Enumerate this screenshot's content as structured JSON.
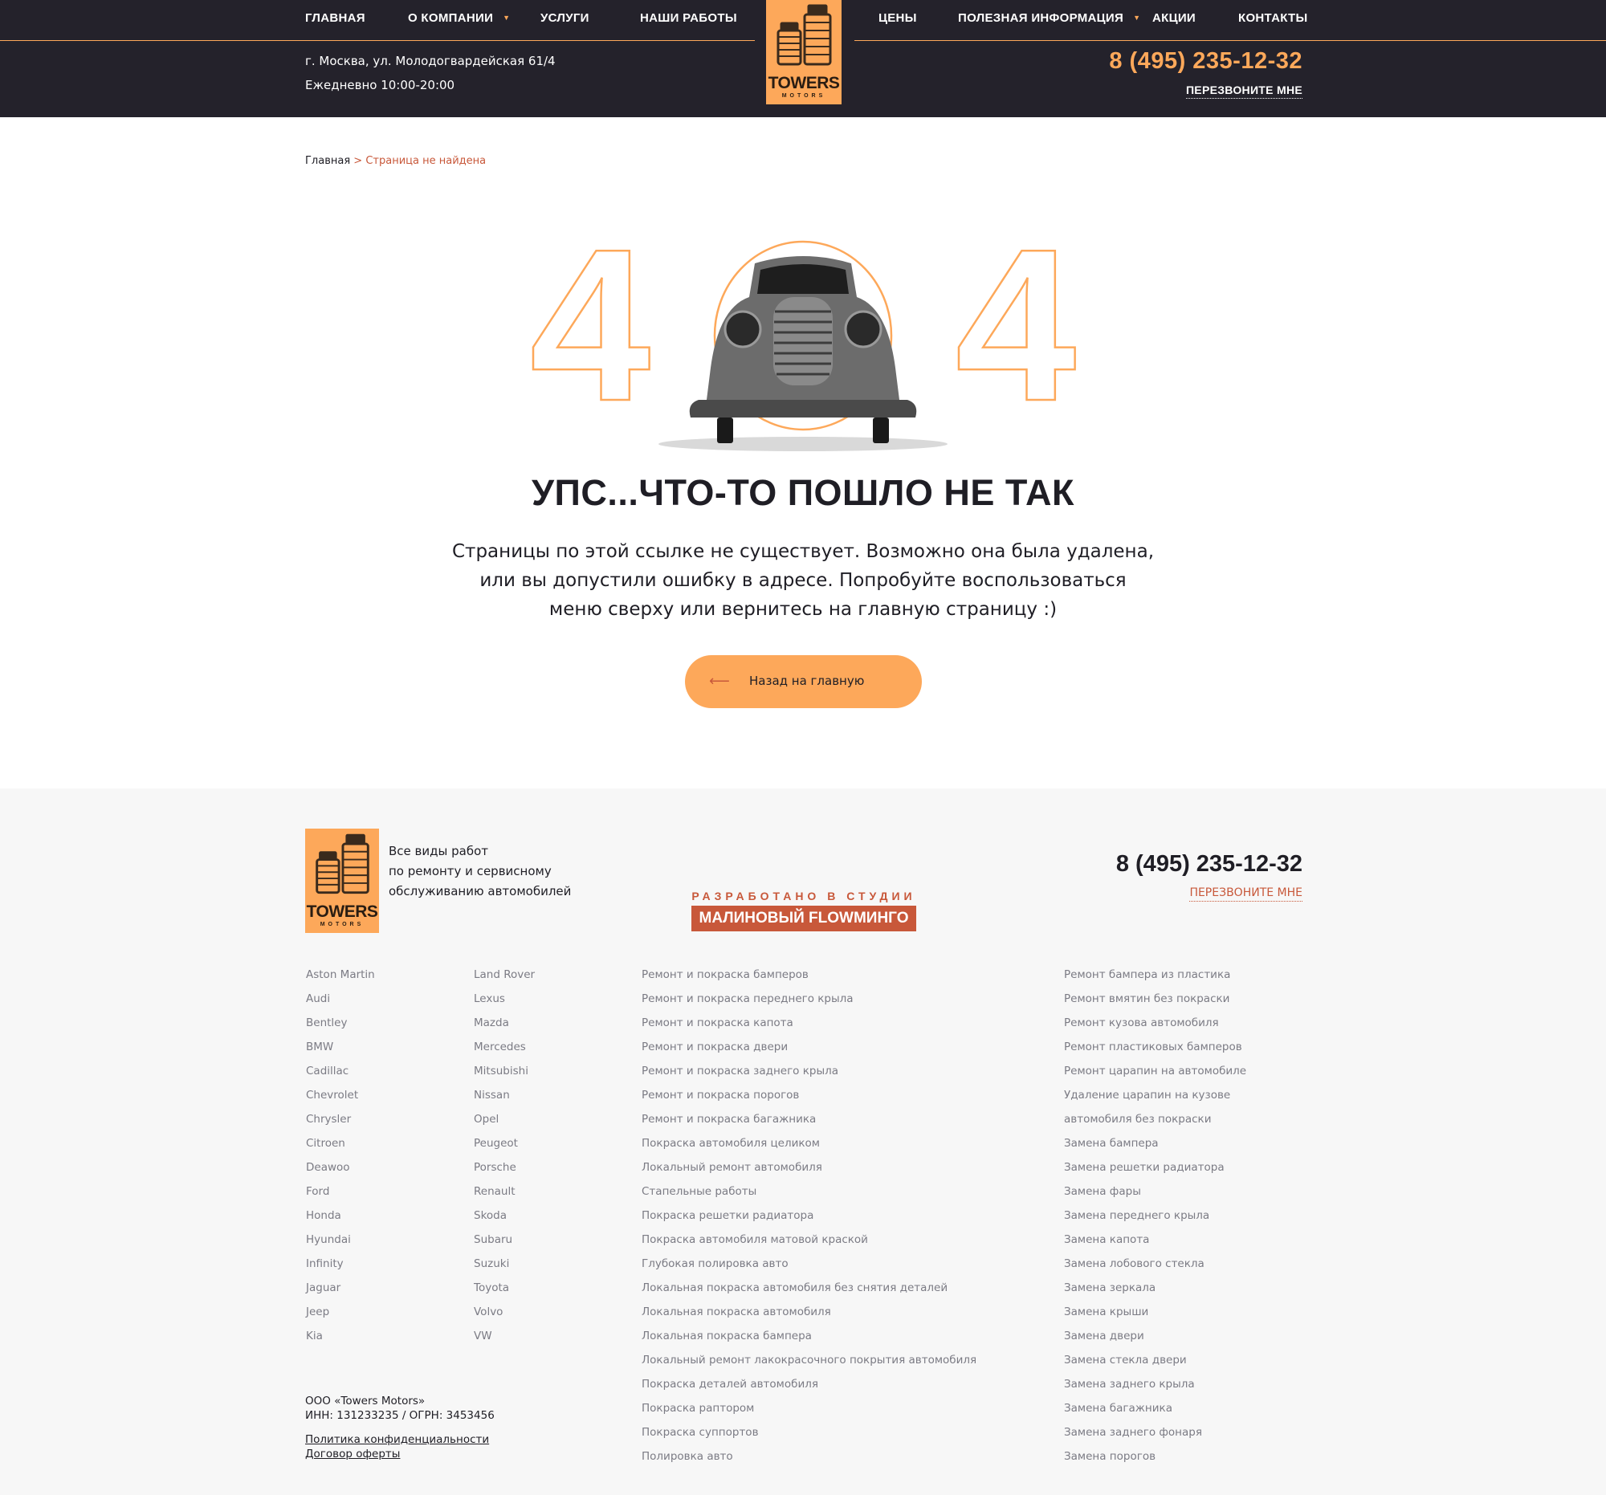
{
  "header": {
    "nav_left": [
      "ГЛАВНАЯ",
      "О КОМПАНИИ",
      "УСЛУГИ",
      "НАШИ РАБОТЫ"
    ],
    "nav_right": [
      "ЦЕНЫ",
      "ПОЛЕЗНАЯ ИНФОРМАЦИЯ",
      "АКЦИИ",
      "КОНТАКТЫ"
    ],
    "address": "г. Москва, ул. Молодогвардейская 61/4",
    "hours": "Ежедневно 10:00-20:00",
    "phone": "8 (495) 235-12-32",
    "callback": "ПЕРЕЗВОНИТЕ МНЕ",
    "logo_word": "TOWERS",
    "logo_sub": "MOTORS"
  },
  "breadcrumb": {
    "home": "Главная",
    "sep": " > ",
    "current": "Страница не найдена"
  },
  "error": {
    "code_left": "4",
    "code_right": "4",
    "headline": "УПС...ЧТО-ТО ПОШЛО НЕ ТАК",
    "message_lines": [
      "Страницы по этой ссылке не существует. Возможно она была удалена,",
      "или вы допустили ошибку в адресе. Попробуйте воспользоваться",
      "меню сверху или вернитесь на главную страницу :)"
    ],
    "back_button": "Назад на главную",
    "back_arrow": "⟵"
  },
  "footer": {
    "tagline_lines": [
      "Все виды работ",
      "по ремонту и сервисному",
      "обслуживанию автомобилей"
    ],
    "studio_line1": "РАЗРАБОТАНО В СТУДИИ",
    "studio_line2": "МАЛИНОВЫЙ FLOWМИНГО",
    "phone": "8 (495) 235-12-32",
    "callback": "ПЕРЕЗВОНИТЕ МНЕ",
    "brands_col1": [
      "Aston Martin",
      "Audi",
      "Bentley",
      "BMW",
      "Cadillac",
      "Chevrolet",
      "Chrysler",
      "Citroen",
      "Deawoo",
      "Ford",
      "Honda",
      "Hyundai",
      "Infinity",
      "Jaguar",
      "Jeep",
      "Kia"
    ],
    "brands_col2": [
      "Land Rover",
      "Lexus",
      "Mazda",
      "Mercedes",
      "Mitsubishi",
      "Nissan",
      "Opel",
      "Peugeot",
      "Porsche",
      "Renault",
      "Skoda",
      "Subaru",
      "Suzuki",
      "Toyota",
      "Volvo",
      "VW"
    ],
    "services_col1": [
      "Ремонт и покраска бамперов",
      "Ремонт и покраска переднего крыла",
      "Ремонт и покраска капота",
      "Ремонт и покраска двери",
      "Ремонт и покраска заднего крыла",
      "Ремонт и покраска порогов",
      "Ремонт и покраска багажника",
      "Покраска автомобиля целиком",
      "Локальный ремонт автомобиля",
      "Стапельные работы",
      "Покраска решетки радиатора",
      "Покраска автомобиля матовой краской",
      "Глубокая полировка авто",
      "Локальная покраска автомобиля без снятия деталей",
      "Локальная покраска автомобиля",
      "Локальная покраска бампера",
      "Локальный ремонт лакокрасочного покрытия автомобиля",
      "Покраска деталей автомобиля",
      "Покраска раптором",
      "Покраска суппортов",
      "Полировка авто"
    ],
    "services_col2": [
      "Ремонт бампера из пластика",
      "Ремонт вмятин без покраски",
      "Ремонт кузова автомобиля",
      "Ремонт пластиковых бамперов",
      "Ремонт царапин на автомобиле",
      "Удаление царапин на кузове",
      "автомобиля без покраски",
      "Замена бампера",
      "Замена решетки радиатора",
      "Замена фары",
      "Замена переднего крыла",
      "Замена капота",
      "Замена лобового стекла",
      "Замена зеркала",
      "Замена крыши",
      "Замена двери",
      "Замена стекла двери",
      "Замена заднего крыла",
      "Замена багажника",
      "Замена заднего фонаря",
      "Замена порогов"
    ],
    "company": "ООО «Towers Motors»",
    "requisites": "ИНН: 131233235 / ОГРН: 3453456",
    "privacy": "Политика конфиденциальности",
    "offer": "Договор оферты"
  },
  "colors": {
    "accent": "#fda85a",
    "dark": "#24222b",
    "red": "#c8583a",
    "footer_bg": "#f7f7f7"
  }
}
